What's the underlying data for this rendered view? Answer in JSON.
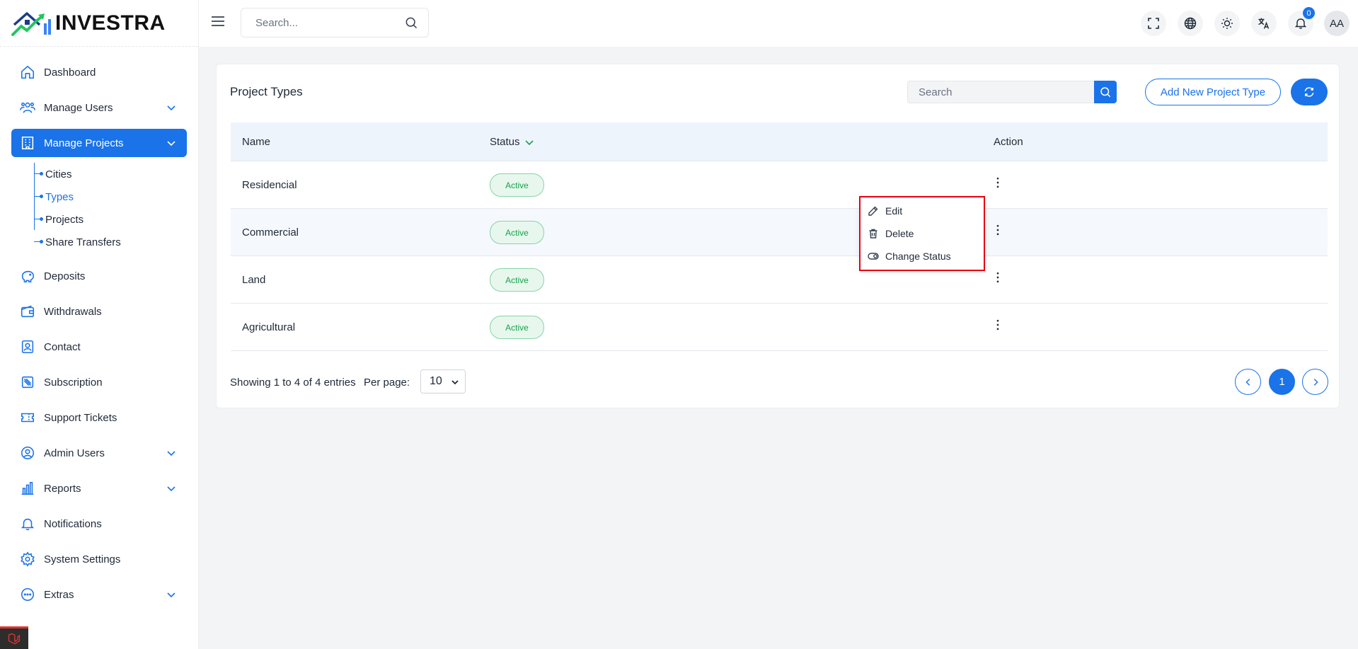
{
  "brand": {
    "name": "INVESTRA"
  },
  "sidebar": {
    "items": [
      {
        "label": "Dashboard",
        "icon": "home-icon"
      },
      {
        "label": "Manage Users",
        "icon": "users-icon",
        "expandable": true
      },
      {
        "label": "Manage Projects",
        "icon": "building-icon",
        "expandable": true,
        "active": true
      },
      {
        "label": "Deposits",
        "icon": "piggy-bank-icon"
      },
      {
        "label": "Withdrawals",
        "icon": "wallet-icon"
      },
      {
        "label": "Contact",
        "icon": "contact-card-icon"
      },
      {
        "label": "Subscription",
        "icon": "subscription-icon"
      },
      {
        "label": "Support Tickets",
        "icon": "ticket-icon"
      },
      {
        "label": "Admin Users",
        "icon": "admin-user-icon",
        "expandable": true
      },
      {
        "label": "Reports",
        "icon": "bar-chart-icon",
        "expandable": true
      },
      {
        "label": "Notifications",
        "icon": "bell-icon"
      },
      {
        "label": "System Settings",
        "icon": "gear-icon"
      },
      {
        "label": "Extras",
        "icon": "more-circle-icon",
        "expandable": true
      }
    ],
    "sub_items": [
      {
        "label": "Cities"
      },
      {
        "label": "Types",
        "active": true
      },
      {
        "label": "Projects"
      },
      {
        "label": "Share Transfers"
      }
    ]
  },
  "topbar": {
    "search_placeholder": "Search...",
    "notification_count": "0",
    "avatar_initials": "AA"
  },
  "card": {
    "title": "Project Types",
    "search_placeholder": "Search",
    "add_button": "Add New Project Type"
  },
  "table": {
    "headers": {
      "name": "Name",
      "status": "Status",
      "action": "Action"
    },
    "rows": [
      {
        "name": "Residencial",
        "status": "Active"
      },
      {
        "name": "Commercial",
        "status": "Active"
      },
      {
        "name": "Land",
        "status": "Active"
      },
      {
        "name": "Agricultural",
        "status": "Active"
      }
    ]
  },
  "footer": {
    "showing": "Showing 1 to 4 of 4 entries",
    "per_page_label": "Per page:",
    "per_page_value": "10",
    "current_page": "1"
  },
  "menu": {
    "items": [
      {
        "label": "Edit",
        "icon": "pencil-icon"
      },
      {
        "label": "Delete",
        "icon": "trash-icon"
      },
      {
        "label": "Change Status",
        "icon": "toggle-icon"
      }
    ]
  },
  "colors": {
    "primary": "#1a73e8",
    "success": "#16a34a",
    "highlight": "#e60012"
  }
}
